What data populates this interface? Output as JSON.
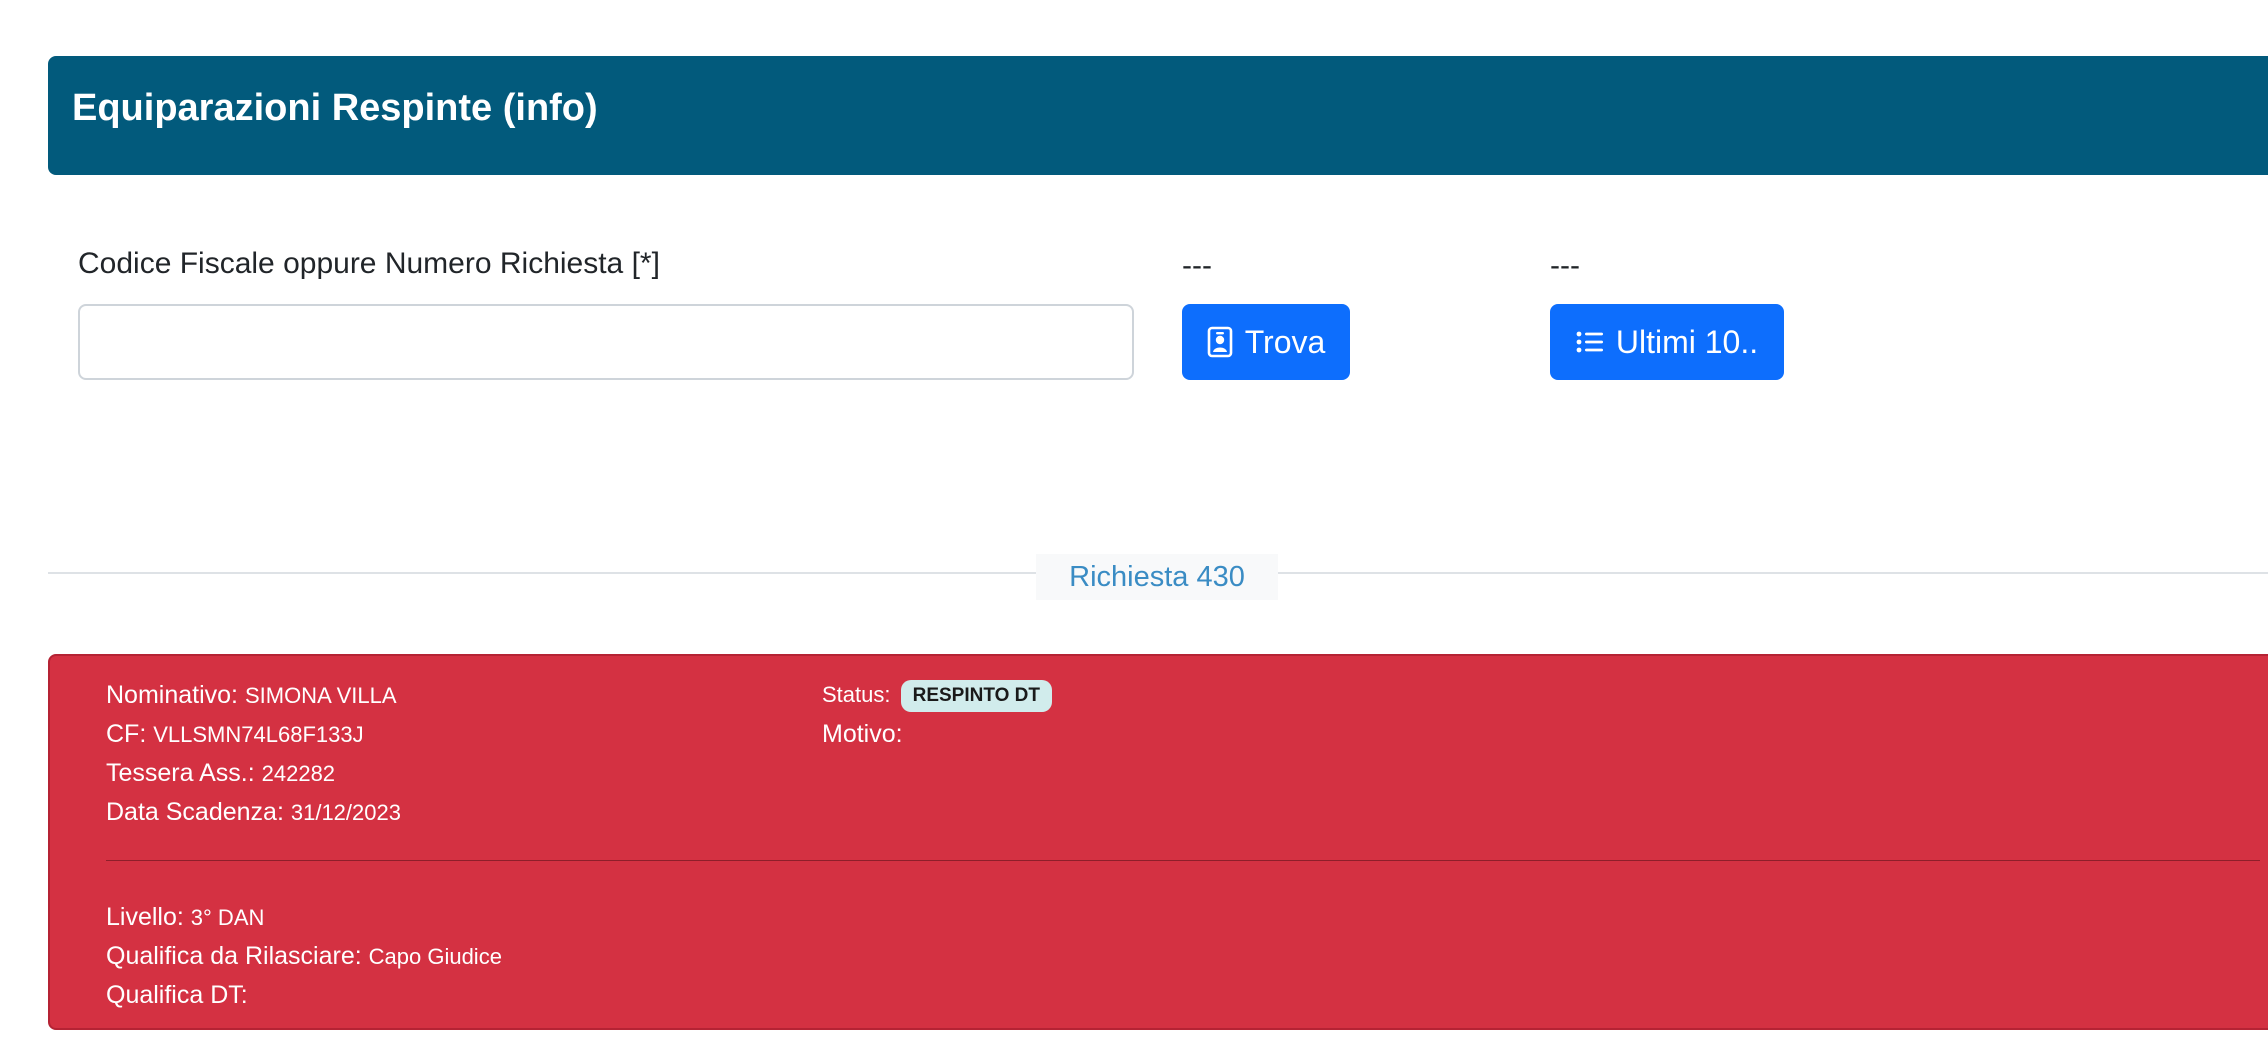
{
  "header": {
    "title": "Equiparazioni Respinte (info)"
  },
  "search": {
    "label": "Codice Fiscale oppure Numero Richiesta [*]",
    "value": "",
    "placeholder": ""
  },
  "actions": {
    "trova_caption": "---",
    "trova_label": "Trova",
    "ultimi_caption": "---",
    "ultimi_label": "Ultimi 10.."
  },
  "request": {
    "divider_label": "Richiesta 430",
    "nominativo_label": "Nominativo:",
    "nominativo_value": "SIMONA VILLA",
    "cf_label": "CF:",
    "cf_value": "VLLSMN74L68F133J",
    "tessera_label": "Tessera Ass.:",
    "tessera_value": "242282",
    "scadenza_label": "Data Scadenza:",
    "scadenza_value": "31/12/2023",
    "status_label": "Status:",
    "status_value": "RESPINTO DT",
    "motivo_label": "Motivo:",
    "motivo_value": "",
    "livello_label": "Livello:",
    "livello_value": "3° DAN",
    "qualifica_label": "Qualifica da Rilasciare:",
    "qualifica_value": "Capo Giudice",
    "qualifica_dt_label": "Qualifica DT:",
    "qualifica_dt_value": ""
  },
  "colors": {
    "header_bg": "#025a7c",
    "button_primary": "#0d6efd",
    "card_danger": "#d43142",
    "badge_bg": "#d1ecec",
    "divider_text": "#3a8cc4"
  },
  "icons": {
    "trova": "person-badge-icon",
    "ultimi": "list-icon"
  }
}
